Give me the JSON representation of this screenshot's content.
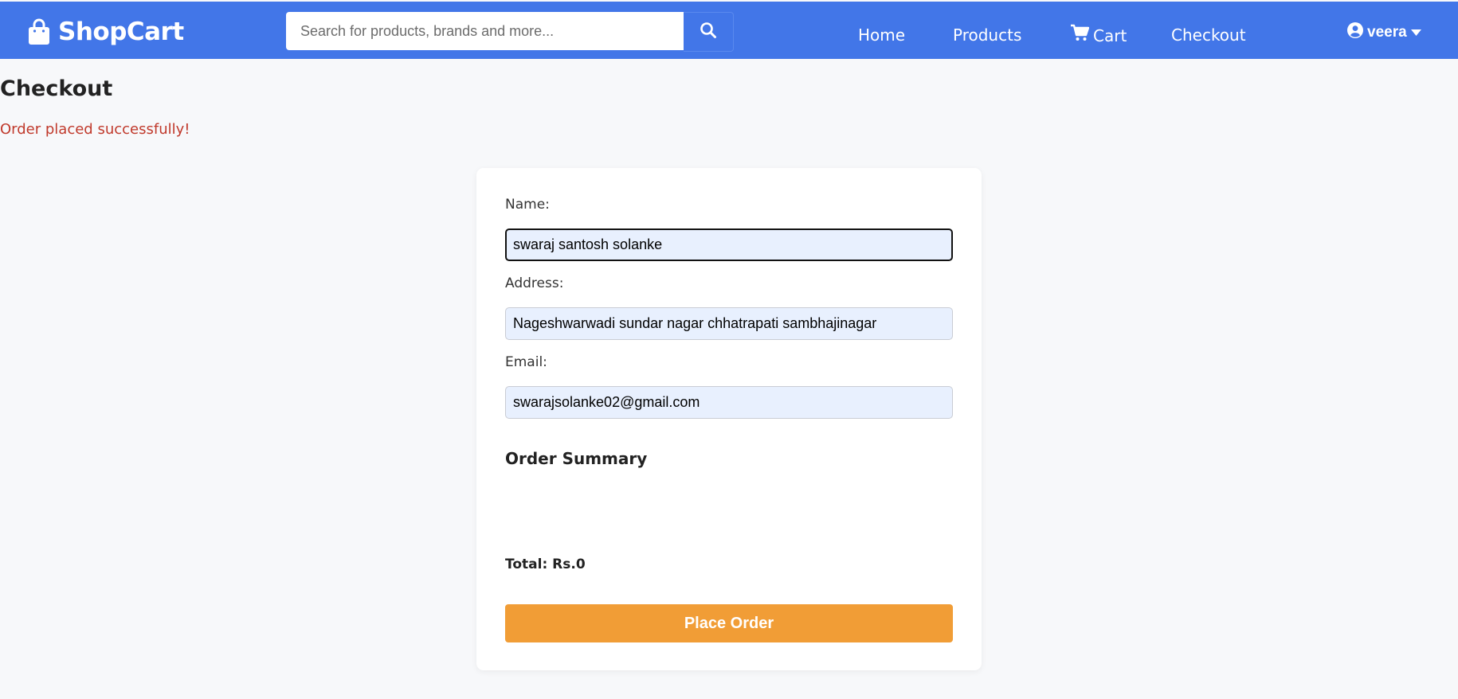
{
  "navbar": {
    "brand": "ShopCart",
    "brand_icon": "shopping-bag-icon",
    "search": {
      "placeholder": "Search for products, brands and more...",
      "value": "",
      "icon": "search-icon"
    },
    "links": {
      "home": "Home",
      "products": "Products",
      "cart": "Cart",
      "checkout": "Checkout"
    },
    "cart_icon": "shopping-cart-icon",
    "user": {
      "name": "veera",
      "icon": "user-circle-icon",
      "caret_icon": "caret-down-icon"
    },
    "background_color": "#4276e8"
  },
  "page": {
    "title": "Checkout",
    "status_message": "Order placed successfully!",
    "status_color": "#c0392b"
  },
  "form": {
    "name": {
      "label": "Name:",
      "value": "swaraj santosh solanke"
    },
    "address": {
      "label": "Address:",
      "value": "Nageshwarwadi sundar nagar chhatrapati sambhajinagar"
    },
    "email": {
      "label": "Email:",
      "value": "swarajsolanke02@gmail.com"
    }
  },
  "summary": {
    "title": "Order Summary",
    "items": [],
    "total": "Total: Rs.0"
  },
  "actions": {
    "place_order": "Place Order",
    "place_order_color": "#f19d36"
  }
}
